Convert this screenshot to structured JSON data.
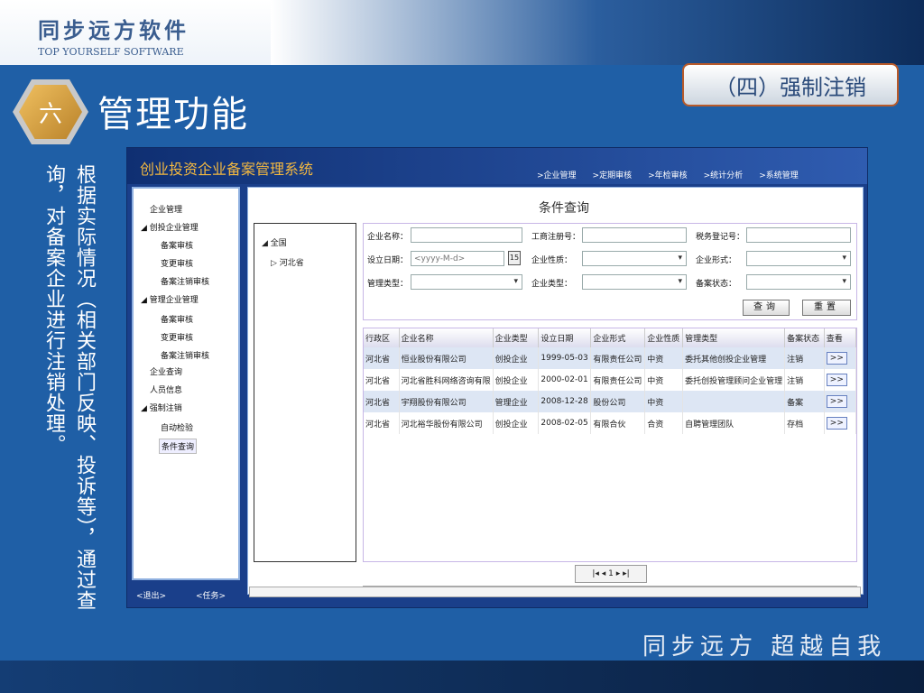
{
  "slide": {
    "logo_cn": "同步远方软件",
    "logo_en": "TOP YOURSELF SOFTWARE",
    "hex_char": "六",
    "section_title": "管理功能",
    "tag": "（四）强制注销",
    "vertical_text": "根据实际情况（相关部门反映、投诉等），通过查询，对备案企业进行注销处理。",
    "slogan": "同步远方 超越自我"
  },
  "app": {
    "title": "创业投资企业备案管理系统",
    "nav": [
      ">企业管理",
      ">定期审核",
      ">年检审核",
      ">统计分析",
      ">系统管理"
    ],
    "sidebar": [
      {
        "label": "企业管理"
      },
      {
        "label": "◢ 创投企业管理"
      },
      {
        "label": "备案审核"
      },
      {
        "label": "变更审核"
      },
      {
        "label": "备案注销审核"
      },
      {
        "label": "◢ 管理企业管理"
      },
      {
        "label": "备案审核"
      },
      {
        "label": "变更审核"
      },
      {
        "label": "备案注销审核"
      },
      {
        "label": "企业查询"
      },
      {
        "label": "人员信息"
      },
      {
        "label": "◢ 强制注销"
      },
      {
        "label": "自动检验"
      },
      {
        "label": "条件查询"
      }
    ],
    "exit": "<退出>",
    "task": "<任务>",
    "tree": {
      "root": "◢ 全国",
      "child": "▷ 河北省"
    },
    "query": {
      "title": "条件查询",
      "labels": {
        "name": "企业名称：",
        "reg": "工商注册号：",
        "tax": "税务登记号：",
        "date": "设立日期：",
        "nature": "企业性质：",
        "form": "企业形式：",
        "mtype": "管理类型：",
        "etype": "企业类型：",
        "status": "备案状态："
      },
      "date_placeholder": "<yyyy-M-d>",
      "cal": "15",
      "search": "查询",
      "reset": "重置"
    },
    "table": {
      "headers": [
        "行政区",
        "企业名称",
        "企业类型",
        "设立日期",
        "企业形式",
        "企业性质",
        "管理类型",
        "备案状态",
        "查看"
      ],
      "rows": [
        [
          "河北省",
          "恒业股份有限公司",
          "创投企业",
          "1999-05-03",
          "有限责任公司",
          "中资",
          "委托其他创投企业管理",
          "注销",
          ">>"
        ],
        [
          "河北省",
          "河北省胜科网络咨询有限",
          "创投企业",
          "2000-02-01",
          "有限责任公司",
          "中资",
          "委托创投管理顾问企业管理",
          "注销",
          ">>"
        ],
        [
          "河北省",
          "宇翔股份有限公司",
          "管理企业",
          "2008-12-28",
          "股份公司",
          "中资",
          "",
          "备案",
          ">>"
        ],
        [
          "河北省",
          "河北裕华股份有限公司",
          "创投企业",
          "2008-02-05",
          "有限合伙",
          "合资",
          "自聘管理团队",
          "存档",
          ">>"
        ]
      ]
    },
    "pager": "|◂ ◂ 1 ▸ ▸|"
  }
}
